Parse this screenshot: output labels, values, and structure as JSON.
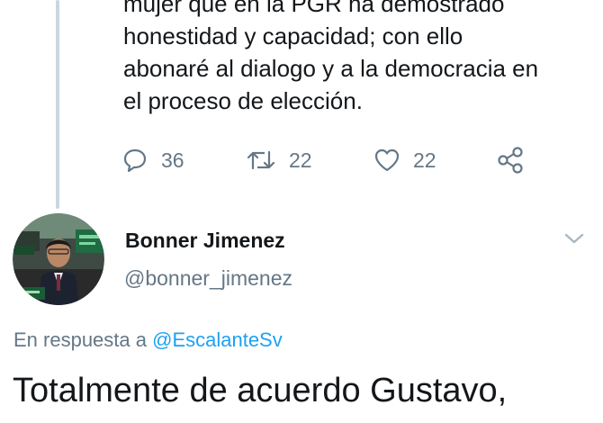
{
  "previous_tweet": {
    "text_lines": [
      "mujer que en la PGR ha demostrado",
      "honestidad y capacidad; con ello",
      "abonaré al dialogo y a la democracia en",
      "el proceso de elección."
    ],
    "actions": {
      "reply": {
        "icon": "speech-bubble-icon",
        "count": "36"
      },
      "retweet": {
        "icon": "retweet-icon",
        "count": "22"
      },
      "like": {
        "icon": "heart-icon",
        "count": "22"
      },
      "share": {
        "icon": "share-icon"
      }
    }
  },
  "reply_tweet": {
    "author": {
      "name": "Bonner Jimenez",
      "handle": "@bonner_jimenez"
    },
    "reply_to_prefix": "En respuesta a ",
    "reply_to_handle": "@EscalanteSv",
    "text_line_1": "Totalmente de acuerdo Gustavo,"
  },
  "colors": {
    "text": "#14171a",
    "secondary": "#657786",
    "link": "#1da1f2",
    "thread_line": "#ccd6dd"
  }
}
